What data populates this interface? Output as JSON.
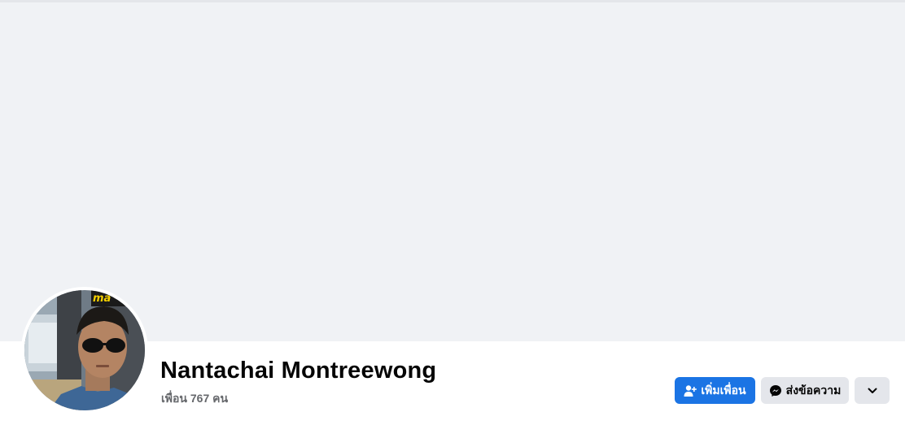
{
  "profile": {
    "name": "Nantachai Montreewong",
    "friends_count_text": "เพื่อน 767 คน"
  },
  "actions": {
    "add_friend_label": "เพิ่มเพื่อน",
    "message_label": "ส่งข้อความ",
    "more_icon": "chevron-down-icon"
  },
  "avatar": {
    "sign_text": "ma"
  },
  "colors": {
    "cover_bg": "#f0f2f5",
    "primary_button": "#1b74e4",
    "secondary_button": "#e4e6eb",
    "name_text": "#050505",
    "muted_text": "#65676b"
  }
}
